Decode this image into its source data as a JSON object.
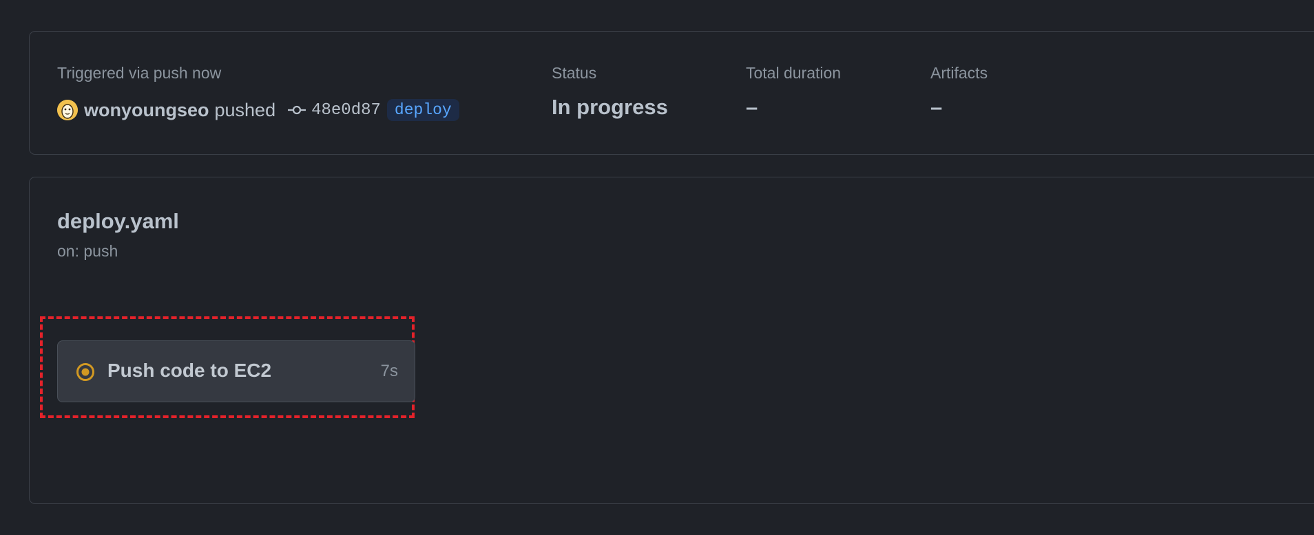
{
  "summary": {
    "trigger_label": "Triggered via push now",
    "actor": "wonyoungseo",
    "action": "pushed",
    "commit_sha": "48e0d87",
    "branch": "deploy",
    "status_label": "Status",
    "status_value": "In progress",
    "duration_label": "Total duration",
    "duration_value": "–",
    "artifacts_label": "Artifacts",
    "artifacts_value": "–"
  },
  "workflow": {
    "file_name": "deploy.yaml",
    "event": "on: push",
    "jobs": [
      {
        "name": "Push code to EC2",
        "duration": "7s",
        "status": "in-progress",
        "status_icon": "in-progress-icon",
        "status_color": "#d29922"
      }
    ]
  },
  "colors": {
    "background": "#1f2228",
    "border": "#3b4048",
    "branch_text": "#58a6ff",
    "branch_bg": "#1d2b46",
    "highlight": "#e3222a"
  }
}
